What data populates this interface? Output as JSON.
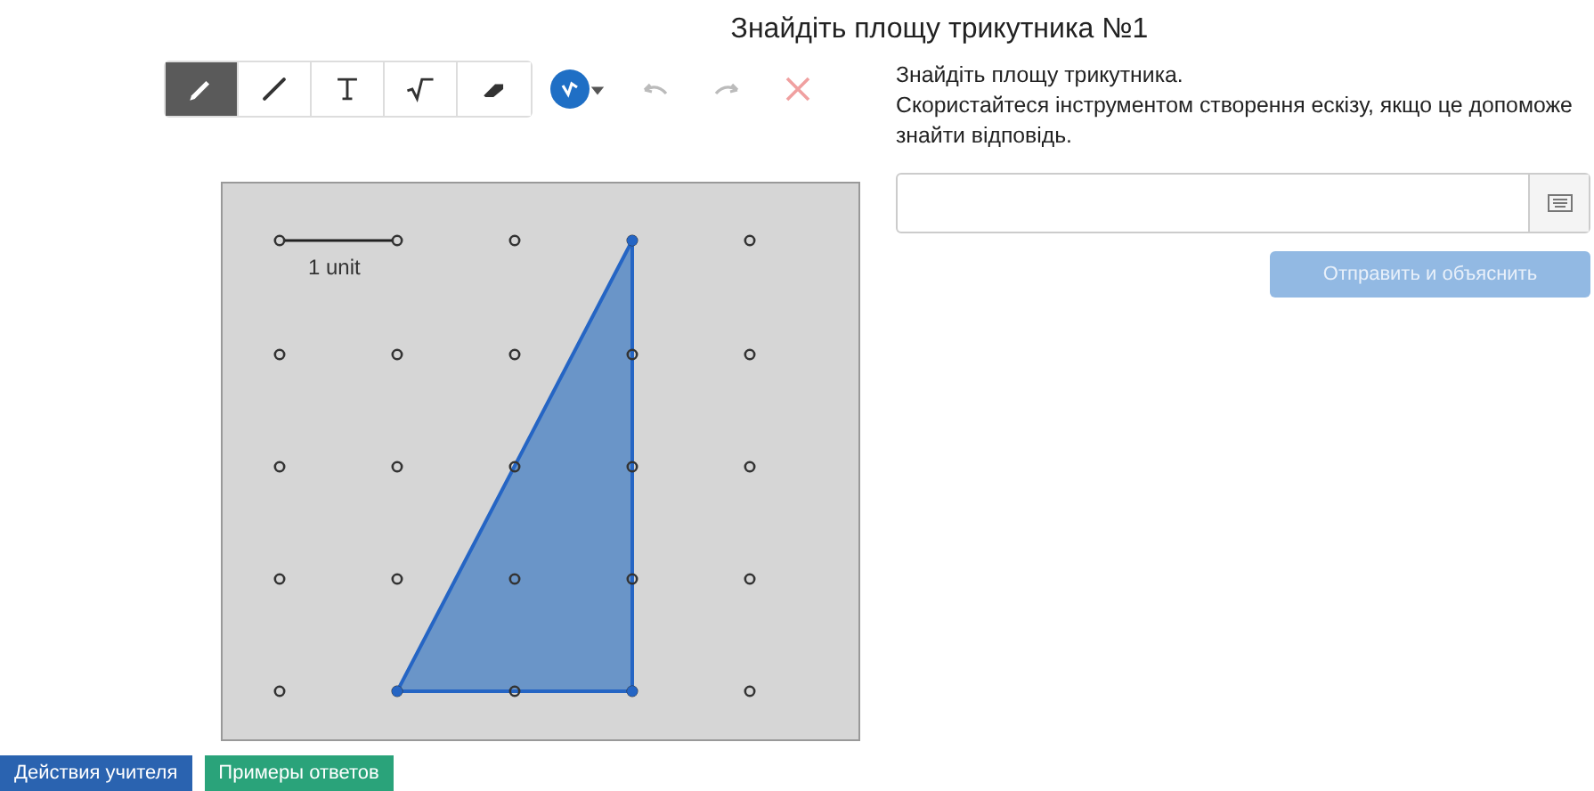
{
  "title": "Знайдіть площу трикутника №1",
  "toolbar": {
    "tools": [
      {
        "kind": "pen",
        "selected": true
      },
      {
        "kind": "line",
        "selected": false
      },
      {
        "kind": "text",
        "selected": false
      },
      {
        "kind": "math",
        "selected": false
      },
      {
        "kind": "eraser",
        "selected": false
      }
    ],
    "color": "#1f6fc5",
    "actions": [
      {
        "kind": "undo",
        "disabled": true
      },
      {
        "kind": "redo",
        "disabled": true
      },
      {
        "kind": "clear",
        "disabled": true
      }
    ]
  },
  "canvas": {
    "scale_label": "1 unit"
  },
  "prompt": [
    "Знайдіть площу трикутника.",
    "Скористайтеся інструментом створення ескізу, якщо це допоможе знайти відповідь."
  ],
  "submit": {
    "label": "Отправить и объяснить",
    "disabled": true
  },
  "footer_buttons": [
    {
      "label": "Действия учителя",
      "color": "#2a63b0"
    },
    {
      "label": "Примеры ответов",
      "color": "#2aa37a"
    }
  ]
}
